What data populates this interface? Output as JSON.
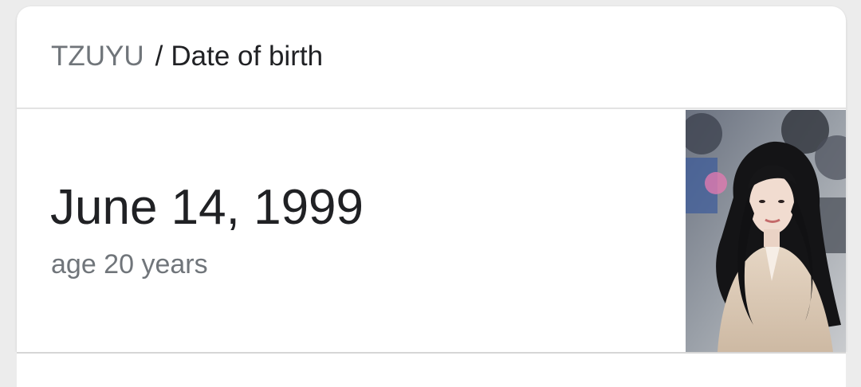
{
  "breadcrumb": {
    "subject": "TZUYU",
    "separator": "/",
    "attribute": "Date of birth"
  },
  "answer": {
    "value": "June 14, 1999",
    "subtext": "age 20 years"
  },
  "thumbnail": {
    "icon": "person-photo"
  },
  "colors": {
    "primary_text": "#202124",
    "secondary_text": "#70757a",
    "card_background": "#ffffff",
    "page_background": "#ececec"
  }
}
